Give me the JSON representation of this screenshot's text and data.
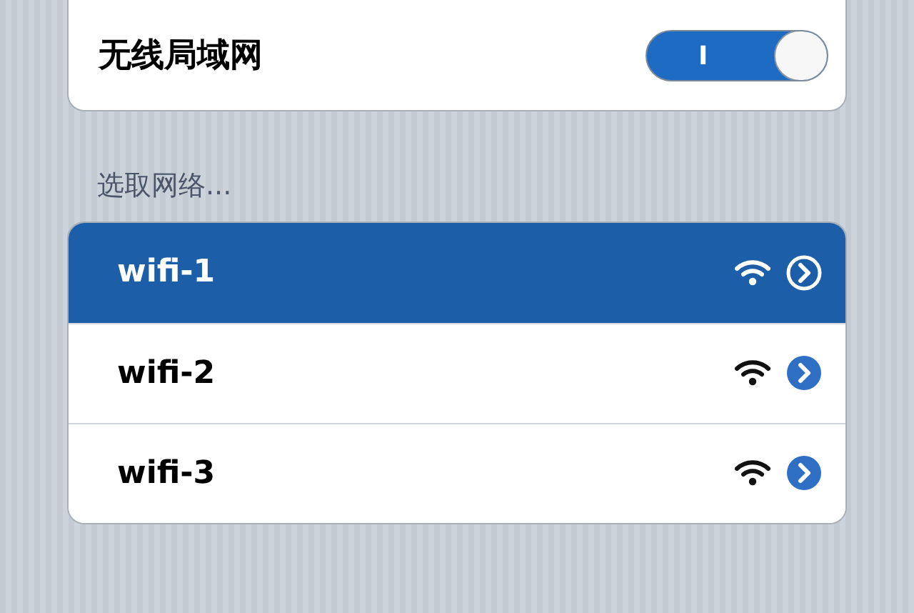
{
  "wifi_switch": {
    "label": "无线局域网",
    "on": true,
    "on_label": "I"
  },
  "section_title": "选取网络...",
  "networks": [
    {
      "name": "wifi-1",
      "selected": true
    },
    {
      "name": "wifi-2",
      "selected": false
    },
    {
      "name": "wifi-3",
      "selected": false
    }
  ]
}
